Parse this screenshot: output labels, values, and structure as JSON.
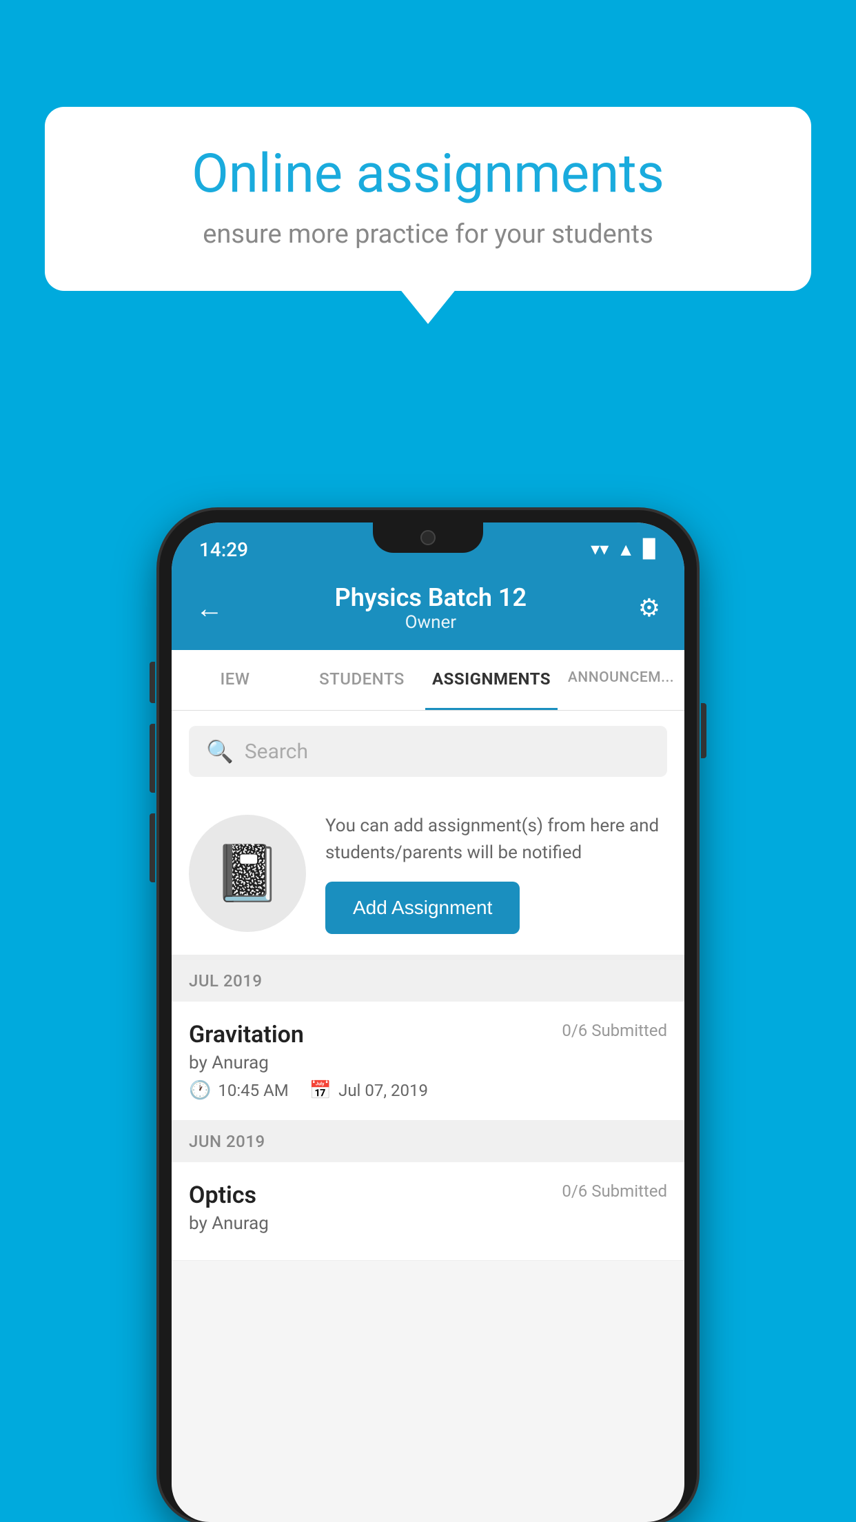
{
  "background": {
    "color": "#00AADD"
  },
  "speech_bubble": {
    "title": "Online assignments",
    "subtitle": "ensure more practice for your students"
  },
  "status_bar": {
    "time": "14:29",
    "wifi": "▲",
    "signal": "▲",
    "battery": "▉"
  },
  "header": {
    "title": "Physics Batch 12",
    "subtitle": "Owner",
    "back_label": "←",
    "settings_label": "⚙"
  },
  "tabs": [
    {
      "label": "IEW",
      "active": false
    },
    {
      "label": "STUDENTS",
      "active": false
    },
    {
      "label": "ASSIGNMENTS",
      "active": true
    },
    {
      "label": "ANNOUNCEM...",
      "active": false
    }
  ],
  "search": {
    "placeholder": "Search"
  },
  "promo": {
    "description": "You can add assignment(s) from here and students/parents will be notified",
    "button_label": "Add Assignment"
  },
  "sections": [
    {
      "month": "JUL 2019",
      "assignments": [
        {
          "name": "Gravitation",
          "submitted": "0/6 Submitted",
          "by": "by Anurag",
          "time": "10:45 AM",
          "date": "Jul 07, 2019"
        }
      ]
    },
    {
      "month": "JUN 2019",
      "assignments": [
        {
          "name": "Optics",
          "submitted": "0/6 Submitted",
          "by": "by Anurag",
          "time": "",
          "date": ""
        }
      ]
    }
  ]
}
